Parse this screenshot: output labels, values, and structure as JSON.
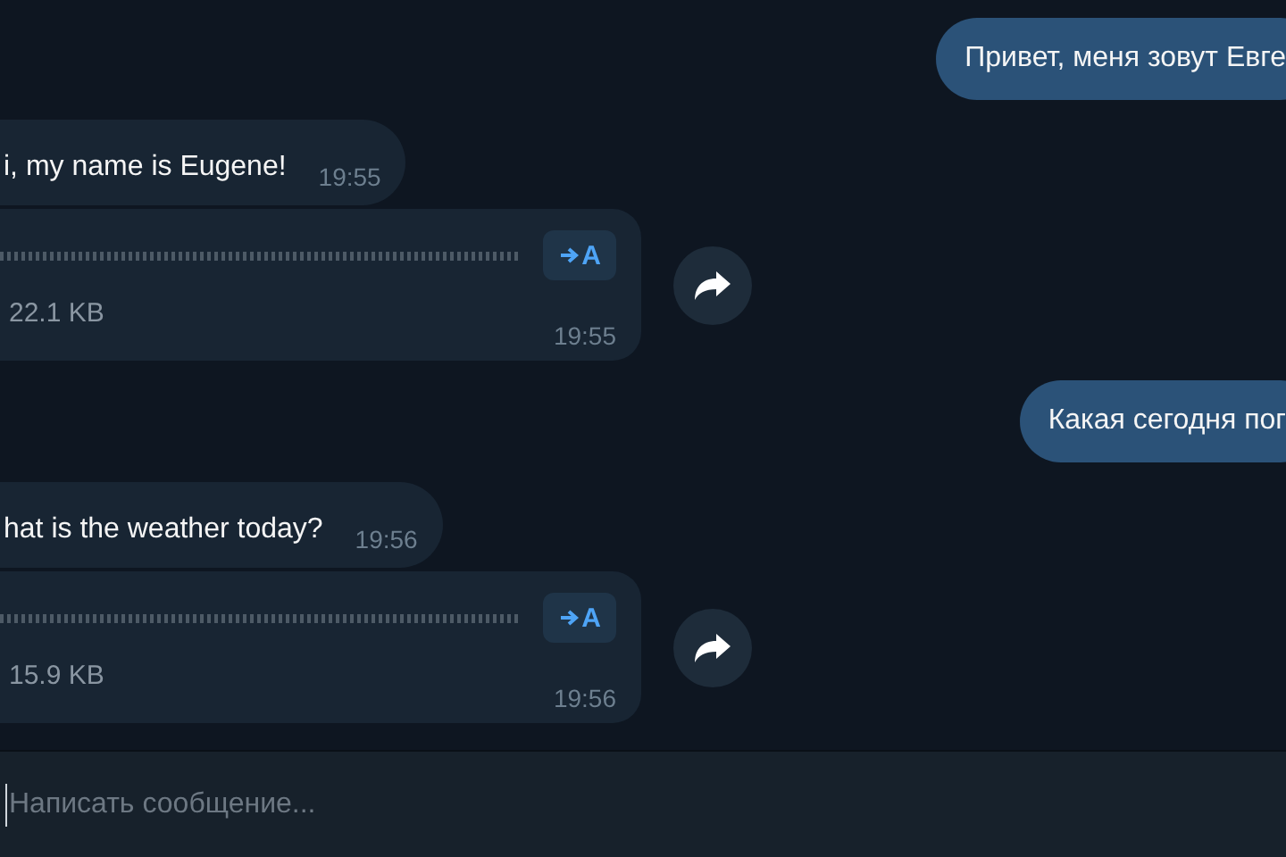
{
  "messages": [
    {
      "kind": "text",
      "outgoing": true,
      "text": "Привет, меня зовут Евге"
    },
    {
      "kind": "text",
      "outgoing": false,
      "text": "i, my name is Eugene!",
      "time": "19:55"
    },
    {
      "kind": "voice",
      "outgoing": false,
      "transcribe_label": "A",
      "size": "22.1 KB",
      "time": "19:55"
    },
    {
      "kind": "text",
      "outgoing": true,
      "text": "Какая сегодня пог"
    },
    {
      "kind": "text",
      "outgoing": false,
      "text": "hat is the weather today?",
      "time": "19:56"
    },
    {
      "kind": "voice",
      "outgoing": false,
      "transcribe_label": "A",
      "size": "15.9 KB",
      "time": "19:56"
    }
  ],
  "composer": {
    "placeholder": "Написать сообщение..."
  }
}
